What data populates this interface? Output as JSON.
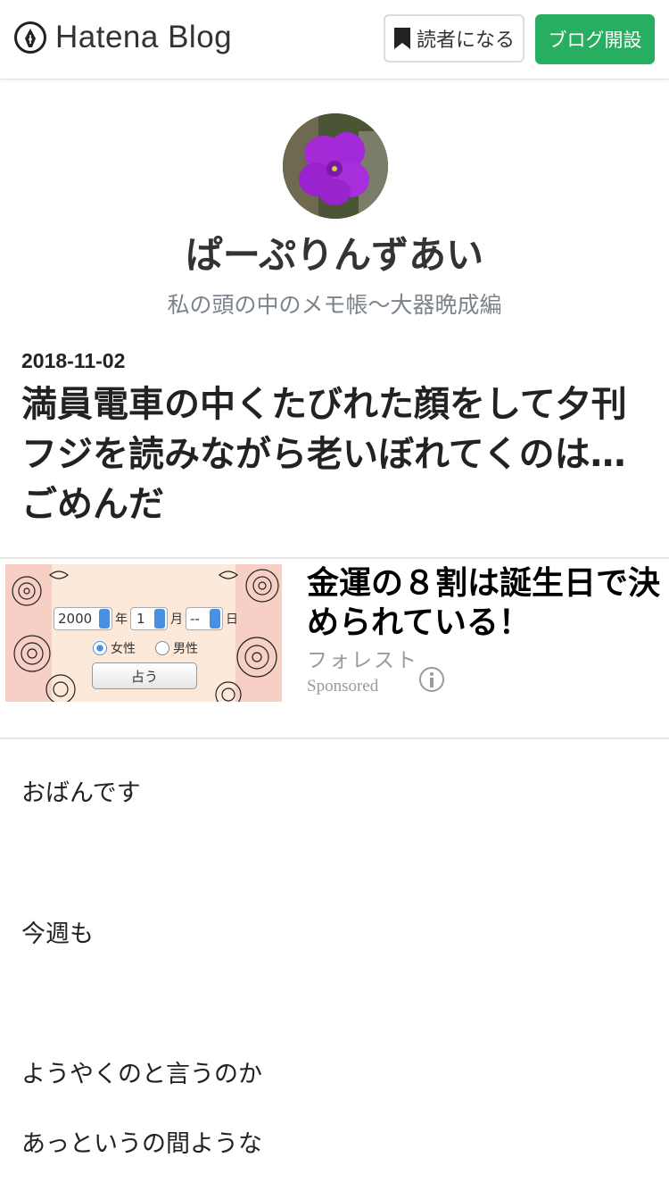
{
  "header": {
    "logo_text": "Hatena Blog",
    "reader_button": "読者になる",
    "open_blog_button": "ブログ開設",
    "accent_color": "#27ae60"
  },
  "blog": {
    "title": "ぱーぷりんずあい",
    "subtitle": "私の頭の中のメモ帳～大器晩成編"
  },
  "entry": {
    "date": "2018-11-02",
    "title": "満員電車の中くたびれた顔をして夕刊フジを読みながら老いぼれてくのは…ごめんだ"
  },
  "ad": {
    "title": "金運の８割は誕生日で決められている！",
    "advertiser": "フォレスト",
    "sponsored": "Sponsored",
    "form": {
      "year": "2000",
      "year_unit": "年",
      "month": "1",
      "month_unit": "月",
      "day": "--",
      "day_unit": "日",
      "female": "女性",
      "male": "男性",
      "submit": "占う"
    }
  },
  "body": {
    "lines": [
      "おばんです",
      "今週も",
      "ようやくのと言うのか",
      "あっというの間ような"
    ]
  }
}
